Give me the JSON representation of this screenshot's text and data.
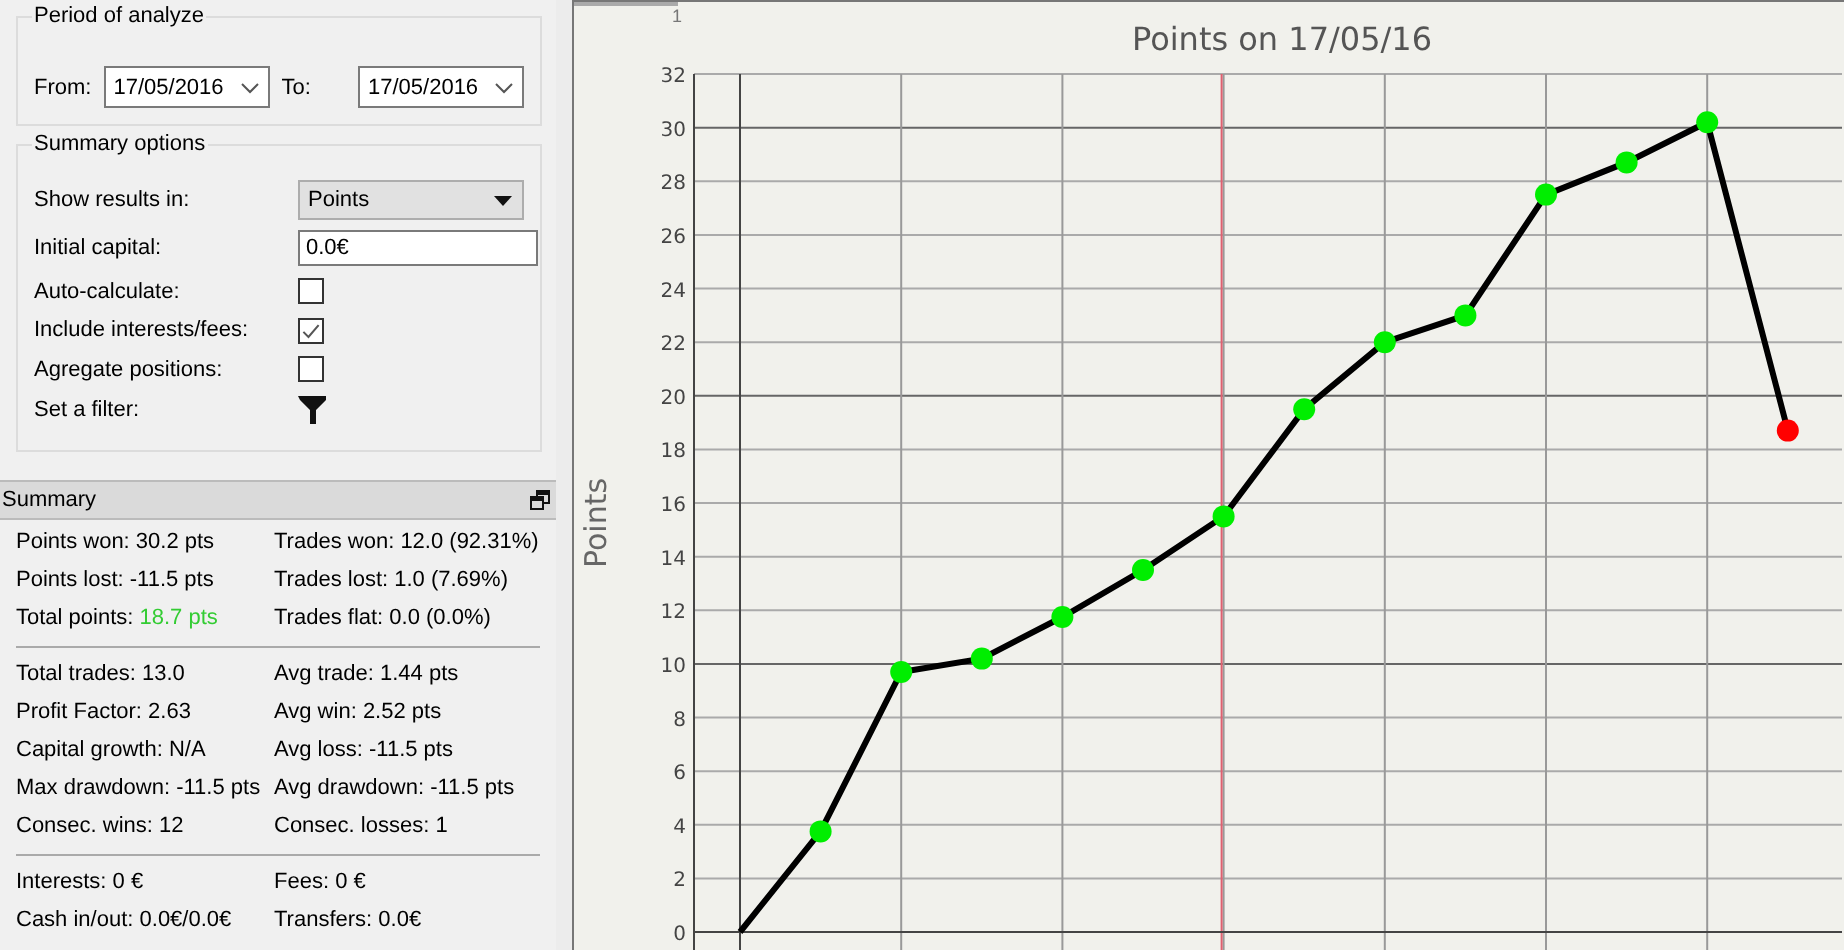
{
  "period": {
    "title": "Period of analyze",
    "from": {
      "label": "From:",
      "value": "17/05/2016"
    },
    "to": {
      "label": "To:",
      "value": "17/05/2016"
    }
  },
  "summary_options": {
    "title": "Summary options",
    "rows": [
      {
        "kind": "select",
        "label": "Show results in:",
        "value": "Points"
      },
      {
        "kind": "input",
        "label": "Initial capital:",
        "value": "0.0€"
      },
      {
        "kind": "checkbox",
        "label": "Auto-calculate:",
        "checked": false
      },
      {
        "kind": "checkbox",
        "label": "Include interests/fees:",
        "checked": true
      },
      {
        "kind": "checkbox",
        "label": "Agregate positions:",
        "checked": false
      },
      {
        "kind": "filter",
        "label": "Set a filter:"
      }
    ]
  },
  "summary": {
    "title": "Summary",
    "sections": [
      [
        {
          "label": "Points won:",
          "value": "30.2 pts",
          "positive": false
        },
        {
          "label": "Trades won:",
          "value": "12.0 (92.31%)",
          "positive": false
        },
        {
          "label": "Points lost:",
          "value": "-11.5 pts",
          "positive": false
        },
        {
          "label": "Trades lost:",
          "value": "1.0 (7.69%)",
          "positive": false
        },
        {
          "label": "Total points:",
          "value": "18.7 pts",
          "positive": true
        },
        {
          "label": "Trades flat:",
          "value": "0.0 (0.0%)",
          "positive": false
        }
      ],
      [
        {
          "label": "Total trades:",
          "value": "13.0",
          "positive": false
        },
        {
          "label": "Avg trade:",
          "value": "1.44 pts",
          "positive": false
        },
        {
          "label": "Profit Factor:",
          "value": "2.63",
          "positive": false
        },
        {
          "label": "Avg win:",
          "value": "2.52 pts",
          "positive": false
        },
        {
          "label": "Capital growth:",
          "value": "N/A",
          "positive": false
        },
        {
          "label": "Avg loss:",
          "value": "-11.5 pts",
          "positive": false
        },
        {
          "label": "Max drawdown:",
          "value": "-11.5 pts",
          "positive": false
        },
        {
          "label": "Avg drawdown:",
          "value": "-11.5 pts",
          "positive": false
        },
        {
          "label": "Consec. wins:",
          "value": "12",
          "positive": false
        },
        {
          "label": "Consec. losses:",
          "value": "1",
          "positive": false
        }
      ],
      [
        {
          "label": "Interests:",
          "value": "0 €",
          "positive": false
        },
        {
          "label": "Fees:",
          "value": "0 €",
          "positive": false
        },
        {
          "label": "Cash in/out:",
          "value": "0.0€/0.0€",
          "positive": false
        },
        {
          "label": "Transfers:",
          "value": "0.0€",
          "positive": false
        }
      ]
    ]
  },
  "ruler": {
    "label": "1"
  },
  "chart_markers": [
    {
      "color": "#00ee00"
    },
    {
      "color": "#00ee00"
    },
    {
      "color": "#00ee00"
    },
    {
      "color": "#00ee00"
    },
    {
      "color": "#00ee00"
    },
    {
      "color": "#00ee00"
    },
    {
      "color": "#00ee00"
    },
    {
      "color": "#00ee00"
    },
    {
      "color": "#00ee00"
    },
    {
      "color": "#00ee00"
    },
    {
      "color": "#00ee00"
    },
    {
      "color": "#00ee00"
    },
    {
      "color": "#ff0000"
    }
  ],
  "chart_data": {
    "type": "line",
    "title": "Points on 17/05/16",
    "ylabel": "Points",
    "categories": [
      null,
      null,
      null,
      null,
      null,
      null,
      null,
      null,
      null,
      null,
      null,
      null,
      null,
      null
    ],
    "series": [
      {
        "color": "#000000",
        "marker": "circle",
        "values": [
          0,
          3.75,
          9.7,
          10.2,
          11.75,
          13.5,
          15.5,
          19.5,
          22,
          23,
          27.5,
          28.7,
          30.2,
          18.7
        ]
      }
    ],
    "grid": true,
    "ylim": [
      0,
      32
    ],
    "yticks": [
      0,
      2,
      4,
      6,
      8,
      10,
      12,
      14,
      16,
      18,
      20,
      22,
      24,
      26,
      28,
      30,
      32
    ]
  }
}
